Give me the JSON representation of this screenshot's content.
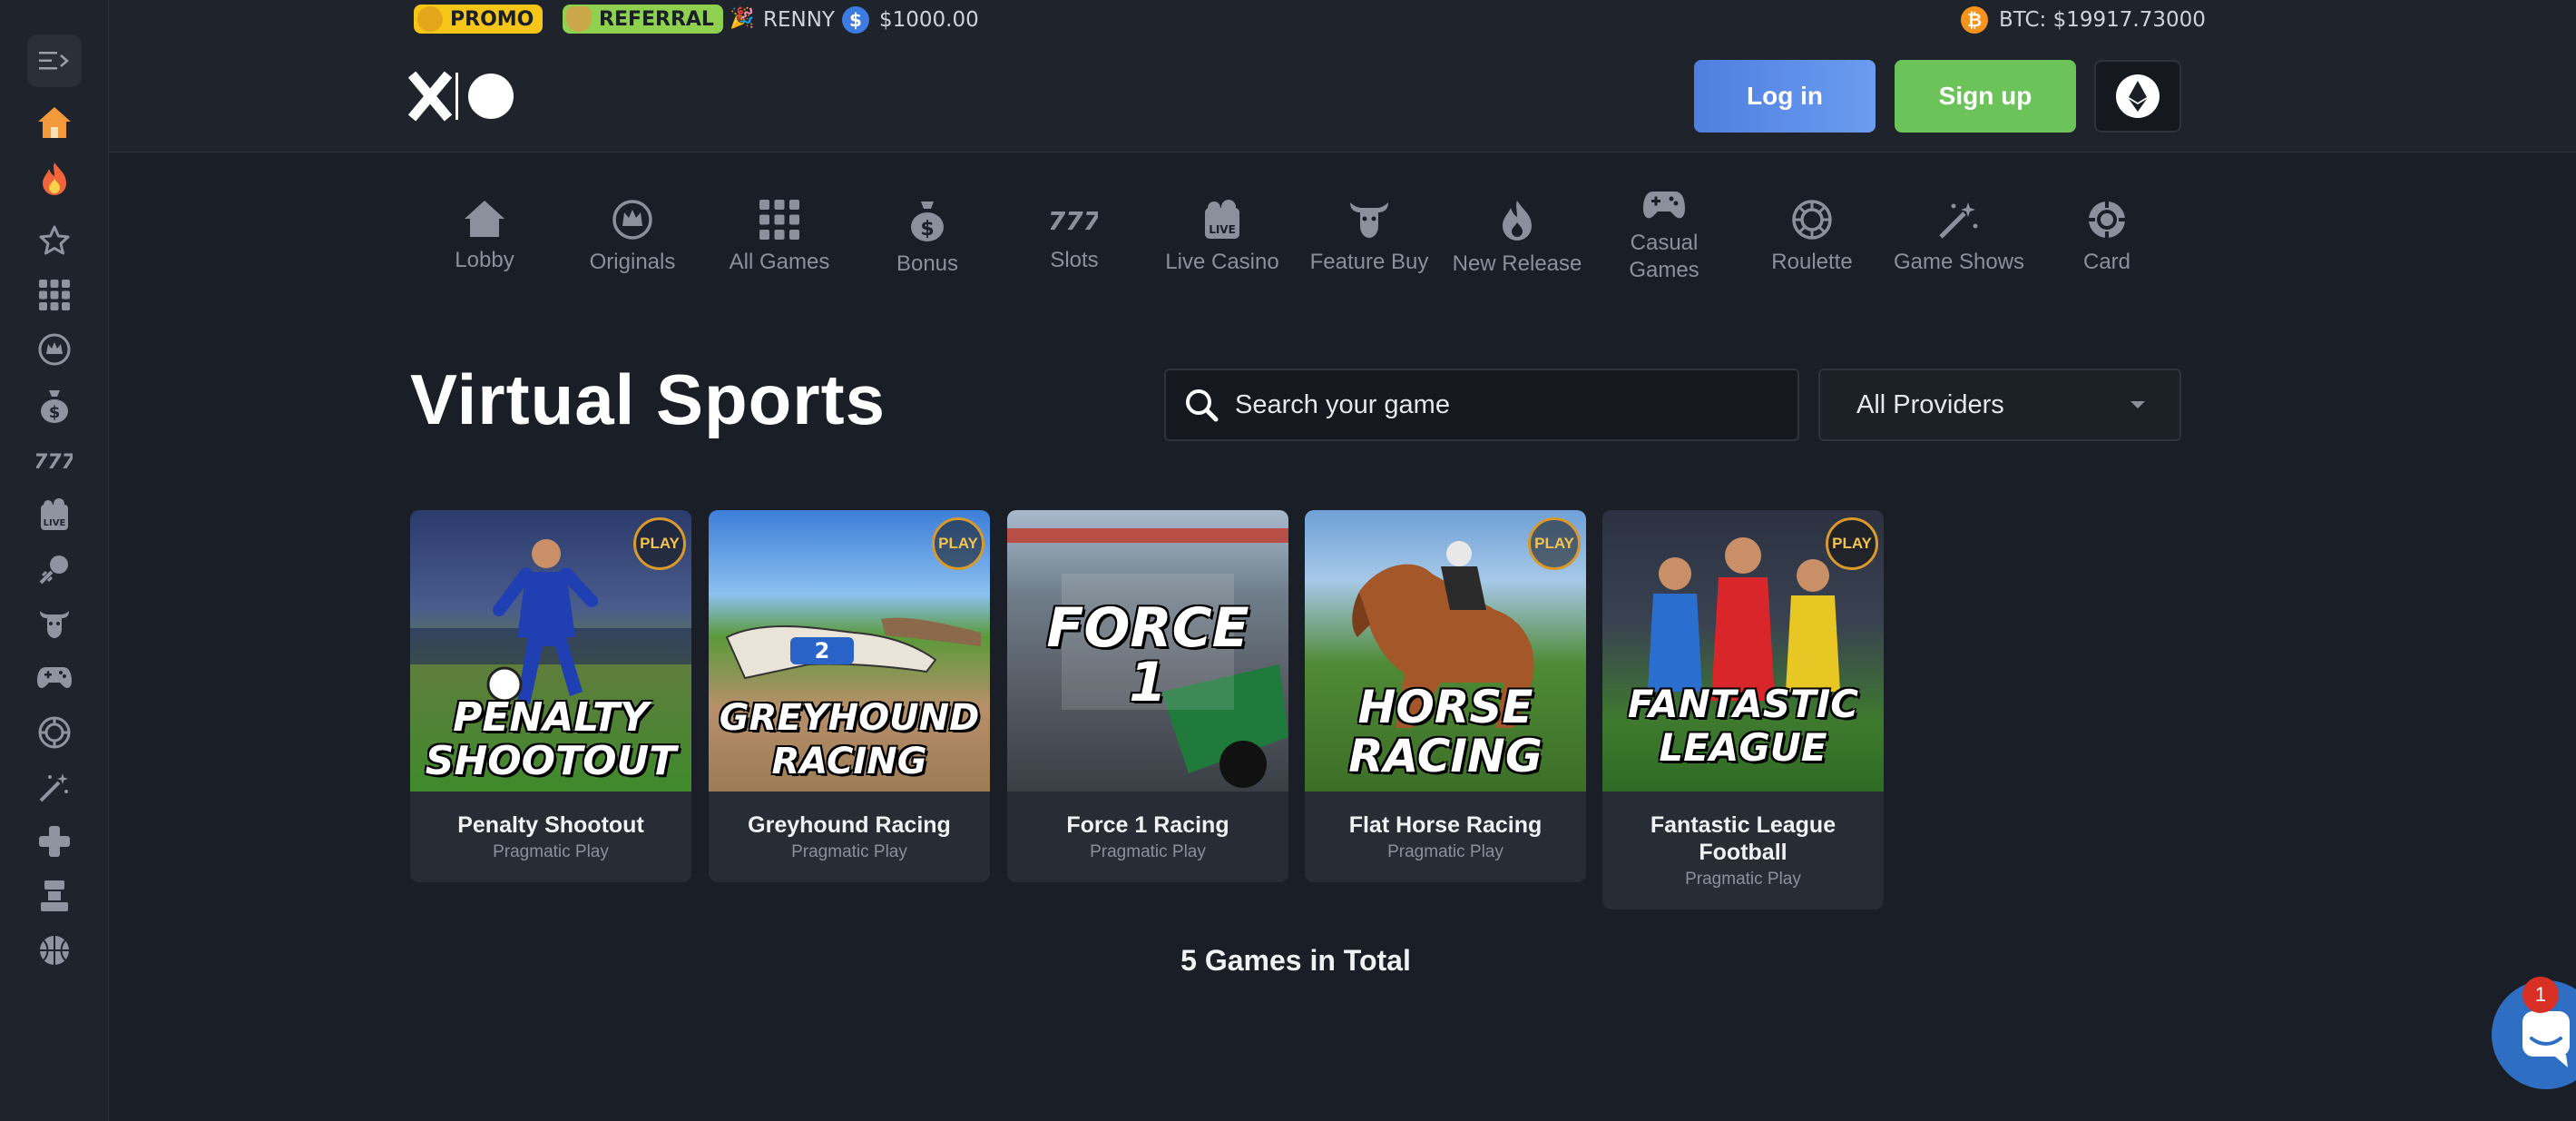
{
  "topbar": {
    "promo_label": "PROMO",
    "referral_label": "REFERRAL",
    "username": "RENNY",
    "balance": "$1000.00",
    "btc_price": "BTC: $19917.73000"
  },
  "header": {
    "logo": "xo",
    "login_label": "Log in",
    "signup_label": "Sign up"
  },
  "categories": [
    {
      "label": "Lobby",
      "icon": "house-icon"
    },
    {
      "label": "Originals",
      "icon": "crown-icon"
    },
    {
      "label": "All Games",
      "icon": "grid-icon"
    },
    {
      "label": "Bonus",
      "icon": "money-bag-icon"
    },
    {
      "label": "Slots",
      "icon": "slots-777-icon"
    },
    {
      "label": "Live Casino",
      "icon": "live-icon"
    },
    {
      "label": "Feature Buy",
      "icon": "bull-icon"
    },
    {
      "label": "New Release",
      "icon": "flame-icon"
    },
    {
      "label": "Casual Games",
      "icon": "gamepad-icon"
    },
    {
      "label": "Roulette",
      "icon": "roulette-icon"
    },
    {
      "label": "Game Shows",
      "icon": "magic-wand-icon"
    },
    {
      "label": "Card",
      "icon": "poker-chip-icon"
    }
  ],
  "page": {
    "title": "Virtual Sports",
    "search_placeholder": "Search your game",
    "provider_select": "All Providers",
    "total_text": "5 Games in Total"
  },
  "games": [
    {
      "name": "Penalty Shootout",
      "provider": "Pragmatic Play",
      "art_lines": [
        "PENALTY",
        "SHOOTOUT"
      ],
      "badge": "PLAY"
    },
    {
      "name": "Greyhound Racing",
      "provider": "Pragmatic Play",
      "art_lines": [
        "GREYHOUND",
        "RACING"
      ],
      "badge": "PLAY"
    },
    {
      "name": "Force 1 Racing",
      "provider": "Pragmatic Play",
      "art_lines": [
        "FORCE",
        "1"
      ],
      "badge": ""
    },
    {
      "name": "Flat Horse Racing",
      "provider": "Pragmatic Play",
      "art_lines": [
        "HORSE",
        "RACING"
      ],
      "badge": "PLAY"
    },
    {
      "name": "Fantastic League Football",
      "provider": "Pragmatic Play",
      "art_lines": [
        "FANTASTIC",
        "LEAGUE"
      ],
      "badge": "PLAY"
    }
  ],
  "chat": {
    "unread_count": "1"
  },
  "colors": {
    "login": "#5b8fe6",
    "signup": "#6cc35a",
    "promo": "#f5c518",
    "referral": "#8fd14f"
  }
}
